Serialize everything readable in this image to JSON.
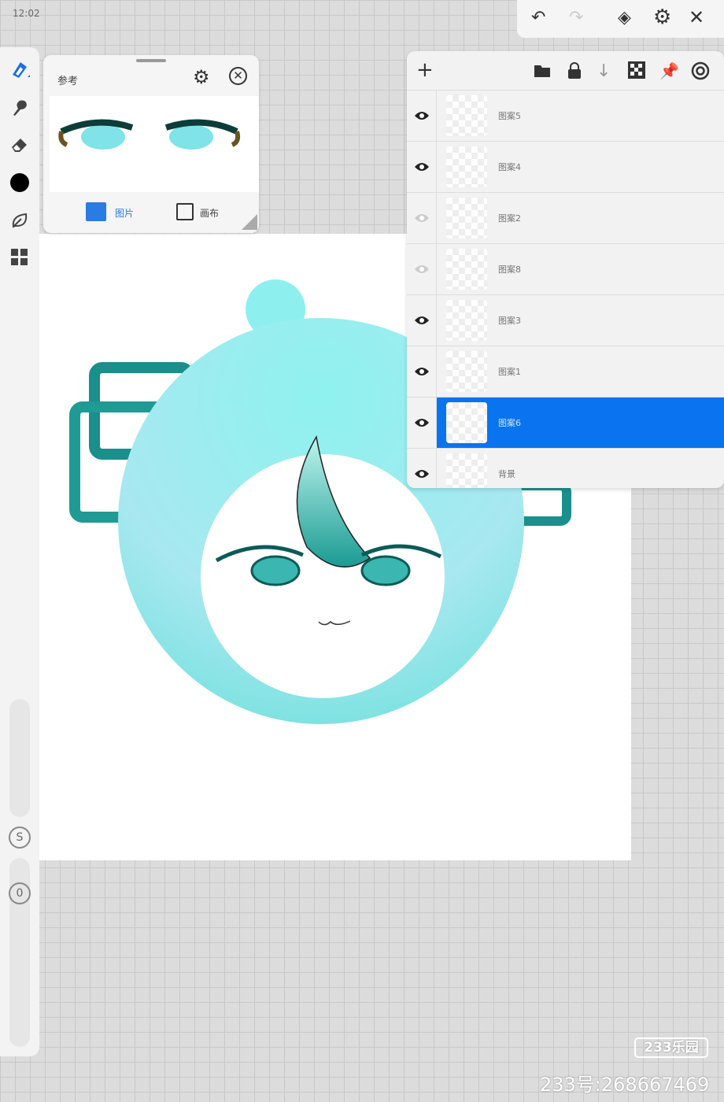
{
  "status": {
    "time": "12:02"
  },
  "reference_panel": {
    "title": "参考",
    "tab_image": "图片",
    "tab_canvas": "画布"
  },
  "layers": [
    {
      "name": "图案5",
      "visible": true
    },
    {
      "name": "图案4",
      "visible": true
    },
    {
      "name": "图案2",
      "visible": false
    },
    {
      "name": "图案8",
      "visible": false
    },
    {
      "name": "图案3",
      "visible": true
    },
    {
      "name": "图案1",
      "visible": true
    },
    {
      "name": "图案6",
      "visible": true,
      "selected": true
    },
    {
      "name": "背景",
      "visible": true
    }
  ],
  "left_tools": {
    "s_badge": "S",
    "o_badge": "0"
  },
  "watermark": {
    "logo": "233乐园",
    "id": "233号:268667469"
  },
  "colors": {
    "accent": "#0a74f0",
    "current_color": "#000000",
    "teal": "#1a8f8c"
  }
}
